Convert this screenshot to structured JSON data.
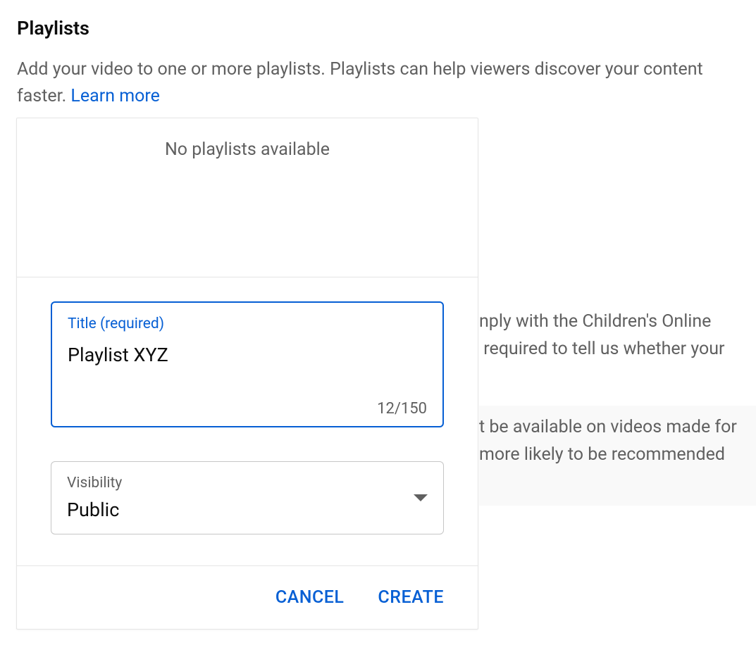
{
  "section": {
    "title": "Playlists",
    "description": "Add your video to one or more playlists. Playlists can help viewers discover your content faster. ",
    "learn_more": "Learn more"
  },
  "background": {
    "line1": "nply with the Children's Online",
    "line2": " required to tell us whether your",
    "box_line1": "t be available on videos made for",
    "box_line2": "more likely to be recommended"
  },
  "popup": {
    "empty_message": "No playlists available",
    "title_field": {
      "label": "Title (required)",
      "value": "Playlist XYZ",
      "counter": "12/150"
    },
    "visibility_field": {
      "label": "Visibility",
      "value": "Public"
    },
    "buttons": {
      "cancel": "CANCEL",
      "create": "CREATE"
    }
  }
}
